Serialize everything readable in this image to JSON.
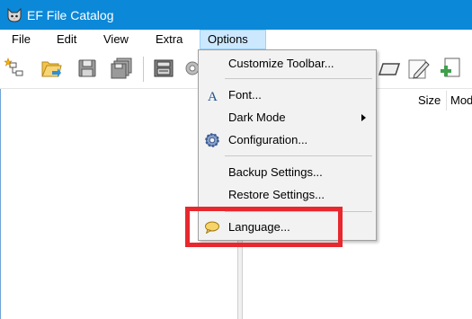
{
  "window": {
    "title": "EF File Catalog",
    "icon": "cat-icon"
  },
  "menubar": {
    "items": [
      {
        "label": "File"
      },
      {
        "label": "Edit"
      },
      {
        "label": "View"
      },
      {
        "label": "Extra"
      },
      {
        "label": "Options",
        "active": true
      }
    ]
  },
  "toolbar": {
    "buttons": [
      "new-catalog-icon",
      "open-folder-icon",
      "save-icon",
      "save-all-icon",
      "catalog-disk-icon",
      "gear-partial-icon",
      "edit-icon",
      "pencil-icon",
      "copy-document-icon"
    ]
  },
  "filelist": {
    "columns": [
      {
        "label": "Size"
      },
      {
        "label": "Mod"
      }
    ]
  },
  "options_menu": {
    "items": [
      {
        "label": "Customize Toolbar...",
        "icon": ""
      },
      {
        "label": "Font...",
        "icon": "font-icon"
      },
      {
        "label": "Dark Mode",
        "icon": "",
        "submenu": true
      },
      {
        "label": "Configuration...",
        "icon": "gear-icon"
      },
      {
        "label": "Backup Settings...",
        "icon": ""
      },
      {
        "label": "Restore Settings...",
        "icon": ""
      },
      {
        "label": "Language...",
        "icon": "speech-bubble-icon"
      }
    ]
  },
  "colors": {
    "titlebar": "#0c88d8",
    "menu_active_bg": "#cce8ff",
    "highlight": "#e8282e",
    "dropdown_bg": "#f2f2f2"
  }
}
